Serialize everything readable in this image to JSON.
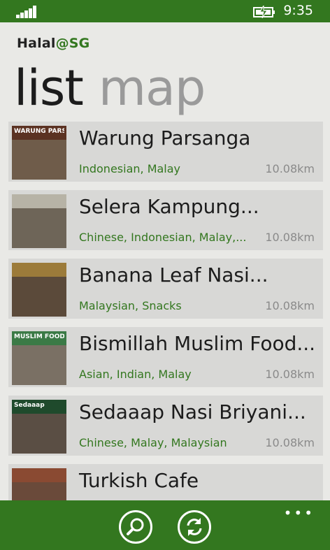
{
  "status": {
    "time": "9:35",
    "signal_icon": "signal-icon",
    "battery_icon": "battery-charging-icon"
  },
  "app": {
    "title_main": "Halal",
    "title_at": "@",
    "title_accent": "SG"
  },
  "pivot": {
    "tab_list": "list",
    "tab_map": "map"
  },
  "list": {
    "items": [
      {
        "name": "Warung Parsanga",
        "cuisine": "Indonesian, Malay",
        "distance": "10.08km",
        "sign": "WARUNG PARSANGA",
        "sign_color": "#5b3222",
        "shop_color": "#6f5c4a"
      },
      {
        "name": "Selera Kampung...",
        "cuisine": "Chinese, Indonesian, Malay,...",
        "distance": "10.08km",
        "sign": "",
        "sign_color": "#b7b3a6",
        "shop_color": "#6e6558"
      },
      {
        "name": "Banana Leaf Nasi...",
        "cuisine": "Malaysian, Snacks",
        "distance": "10.08km",
        "sign": "",
        "sign_color": "#9c7b3a",
        "shop_color": "#5b4a3a"
      },
      {
        "name": "Bismillah Muslim Food...",
        "cuisine": "Asian, Indian, Malay",
        "distance": "10.08km",
        "sign": "MUSLIM FOOD STALL",
        "sign_color": "#3b7a46",
        "shop_color": "#7a7064"
      },
      {
        "name": "Sedaaap Nasi Briyani...",
        "cuisine": "Chinese, Malay, Malaysian",
        "distance": "10.08km",
        "sign": "Sedaaap",
        "sign_color": "#1f4a2c",
        "shop_color": "#5a4e44"
      },
      {
        "name": "Turkish Cafe",
        "cuisine": "",
        "distance": "",
        "sign": "",
        "sign_color": "#8a4a32",
        "shop_color": "#6a4a3a"
      }
    ]
  },
  "appbar": {
    "search_icon": "search-icon",
    "refresh_icon": "refresh-icon",
    "more": "•••"
  }
}
